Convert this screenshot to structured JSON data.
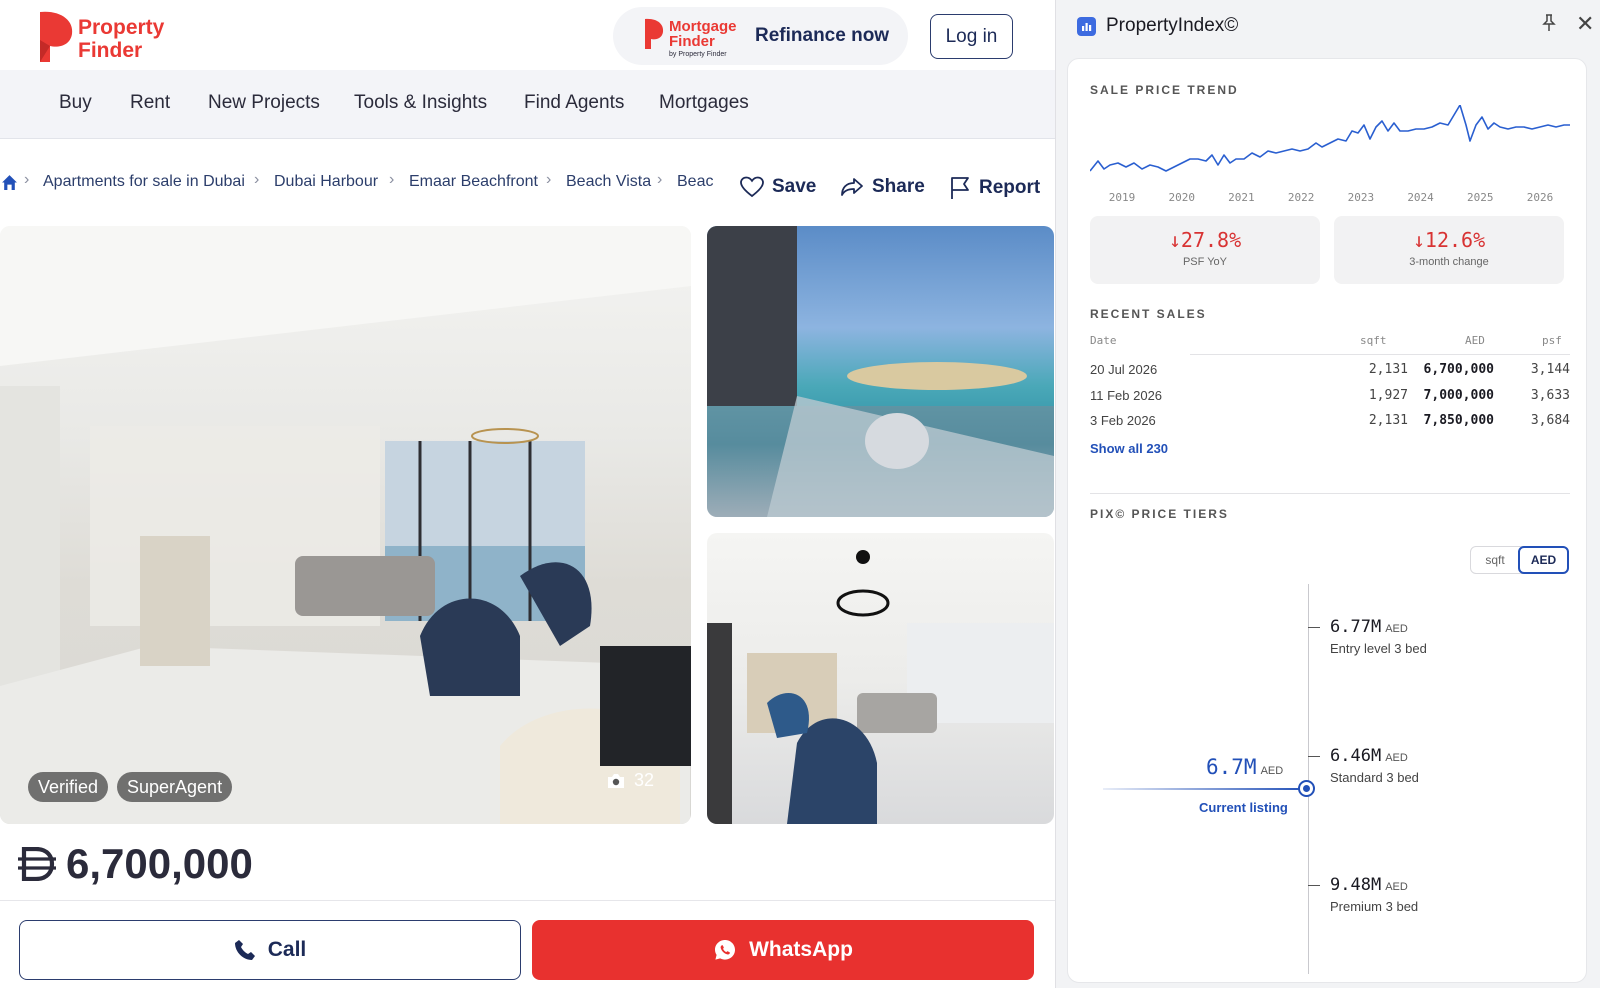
{
  "header": {
    "logo_line1": "Property",
    "logo_line2": "Finder",
    "mortgage_logo_line1": "Mortgage",
    "mortgage_logo_line2": "Finder",
    "mortgage_logo_by": "by Property Finder",
    "refinance_label": "Refinance now",
    "login_label": "Log in"
  },
  "nav": {
    "items": [
      {
        "label": "Buy"
      },
      {
        "label": "Rent"
      },
      {
        "label": "New Projects"
      },
      {
        "label": "Tools & Insights"
      },
      {
        "label": "Find Agents"
      },
      {
        "label": "Mortgages"
      }
    ]
  },
  "breadcrumb": {
    "items": [
      {
        "label": "Apartments for sale in Dubai"
      },
      {
        "label": "Dubai Harbour"
      },
      {
        "label": "Emaar Beachfront"
      },
      {
        "label": "Beach Vista"
      },
      {
        "label": "Beac"
      }
    ]
  },
  "actions": {
    "save_label": "Save",
    "share_label": "Share",
    "report_label": "Report"
  },
  "gallery": {
    "badges": [
      "Verified",
      "SuperAgent"
    ],
    "photo_count": "32"
  },
  "listing": {
    "price": "6,700,000",
    "call_label": "Call",
    "whatsapp_label": "WhatsApp"
  },
  "panel": {
    "title": "PropertyIndex©",
    "trend_title": "SALE PRICE TREND",
    "trend_years": [
      "2019",
      "2020",
      "2021",
      "2022",
      "2023",
      "2024",
      "2025",
      "2026"
    ],
    "stats": [
      {
        "value": "↓27.8%",
        "label": "PSF YoY"
      },
      {
        "value": "↓12.6%",
        "label": "3-month change"
      }
    ],
    "recent_sales_title": "RECENT SALES",
    "sales_headers": {
      "date": "Date",
      "sqft": "sqft",
      "aed": "AED",
      "psf": "psf"
    },
    "sales": [
      {
        "date": "20 Jul 2026",
        "sqft": "2,131",
        "aed": "6,700,000",
        "psf": "3,144"
      },
      {
        "date": "11 Feb 2026",
        "sqft": "1,927",
        "aed": "7,000,000",
        "psf": "3,633"
      },
      {
        "date": "3 Feb 2026",
        "sqft": "2,131",
        "aed": "7,850,000",
        "psf": "3,684"
      }
    ],
    "show_all_label": "Show all 230",
    "tiers_title": "PIX© PRICE TIERS",
    "toggle": {
      "sqft": "sqft",
      "aed": "AED",
      "selected": "AED"
    },
    "tiers": [
      {
        "value": "6.77M",
        "unit": "AED",
        "label": "Entry level 3 bed"
      },
      {
        "value": "6.46M",
        "unit": "AED",
        "label": "Standard 3 bed"
      },
      {
        "value": "9.48M",
        "unit": "AED",
        "label": "Premium 3 bed"
      }
    ],
    "current": {
      "value": "6.7M",
      "unit": "AED",
      "label": "Current listing"
    }
  },
  "colors": {
    "brand_red": "#ea3934",
    "navy": "#1c2a57",
    "accent_blue": "#2250b8",
    "down_red": "#d83333",
    "whatsapp_button": "#e8312f"
  }
}
